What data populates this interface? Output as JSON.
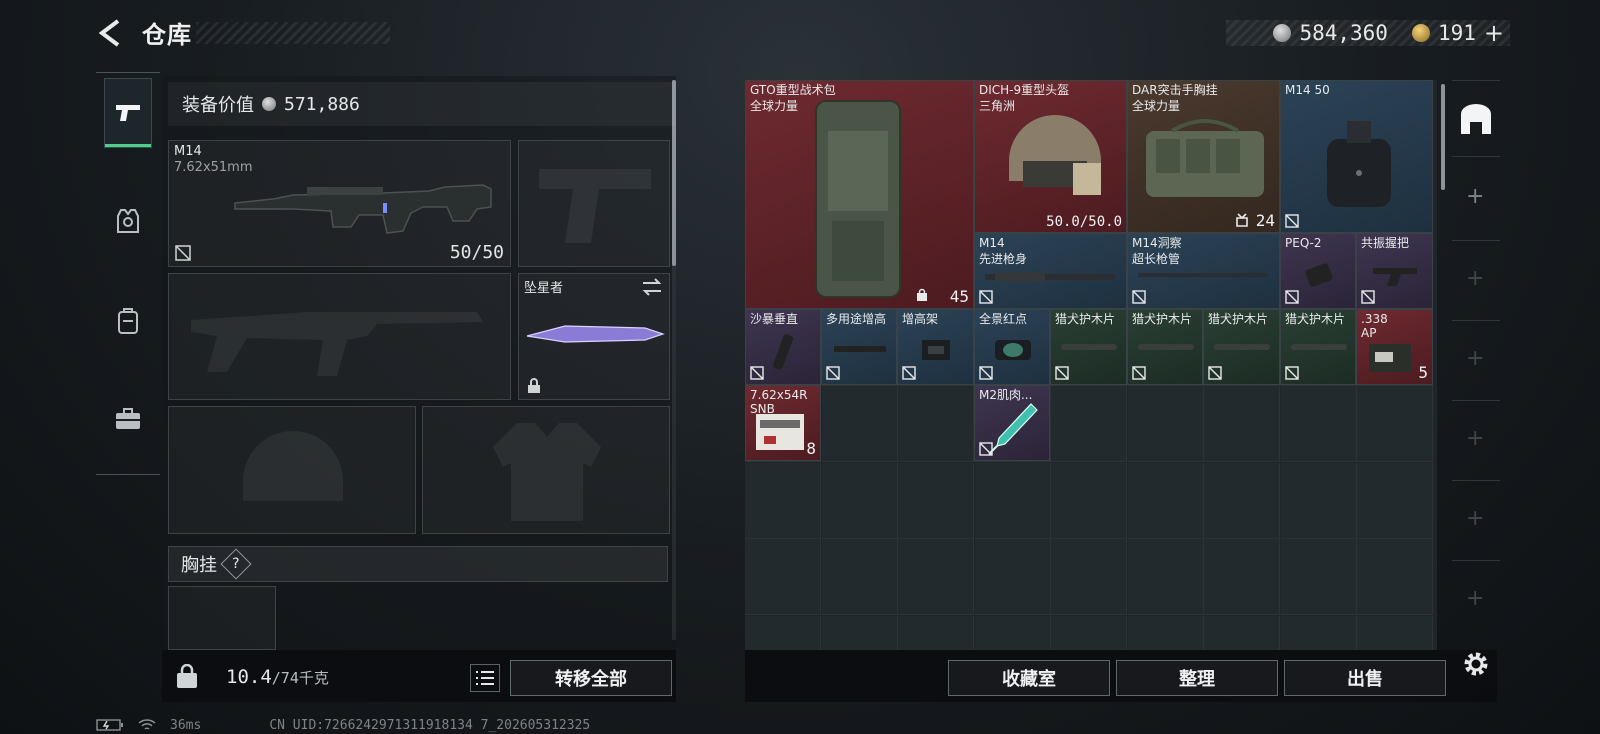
{
  "header": {
    "title": "仓库",
    "currency_silver": "584,360",
    "currency_gold": "191",
    "add_label": "+"
  },
  "left": {
    "equip_value_label": "装备价值",
    "equip_value": "571,886",
    "primary_weapon": {
      "name": "M14",
      "caliber": "7.62x51mm",
      "ammo": "50/50"
    },
    "melee": {
      "name": "坠星者"
    },
    "chest_rig_label": "胸挂",
    "help_glyph": "?",
    "weight_current": "10.4",
    "weight_capacity": "/74千克",
    "transfer_all": "转移全部"
  },
  "grid": {
    "items": [
      {
        "id": "backpack",
        "name": "GTO重型战术包",
        "sub": "全球力量",
        "count": "45",
        "color": "red"
      },
      {
        "id": "helmet",
        "name": "DICH-9重型头盔",
        "sub": "三角洲",
        "count": "50.0/50.0",
        "color": "red"
      },
      {
        "id": "chest",
        "name": "DAR突击手胸挂",
        "sub": "全球力量",
        "count": "24",
        "color": "brown"
      },
      {
        "id": "mag",
        "name": "M14 50",
        "sub": "",
        "count": "",
        "color": "blue"
      },
      {
        "id": "barrel1",
        "name": "M14",
        "sub": "先进枪身",
        "count": "",
        "color": "blue"
      },
      {
        "id": "barrel2",
        "name": "M14洞察",
        "sub": "超长枪管",
        "count": "",
        "color": "blue"
      },
      {
        "id": "peq",
        "name": "PEQ-2",
        "sub": "",
        "count": "",
        "color": "purple"
      },
      {
        "id": "grip",
        "name": "共振握把",
        "sub": "",
        "count": "",
        "color": "purple"
      },
      {
        "id": "vgrip",
        "name": "沙暴垂直",
        "sub": "",
        "count": "",
        "color": "purple"
      },
      {
        "id": "riser1",
        "name": "多用途增高",
        "sub": "",
        "count": "",
        "color": "blue"
      },
      {
        "id": "riser2",
        "name": "增高架",
        "sub": "",
        "count": "",
        "color": "blue"
      },
      {
        "id": "reddot",
        "name": "全景红点",
        "sub": "",
        "count": "",
        "color": "blue"
      },
      {
        "id": "guard1",
        "name": "猎犬护木片",
        "sub": "",
        "count": "",
        "color": "green"
      },
      {
        "id": "guard2",
        "name": "猎犬护木片",
        "sub": "",
        "count": "",
        "color": "green"
      },
      {
        "id": "guard3",
        "name": "猎犬护木片",
        "sub": "",
        "count": "",
        "color": "green"
      },
      {
        "id": "guard4",
        "name": "猎犬护木片",
        "sub": "",
        "count": "",
        "color": "green"
      },
      {
        "id": "ammo338",
        "name": ".338",
        "sub": "AP",
        "count": "5",
        "color": "red"
      },
      {
        "id": "ammo762",
        "name": "7.62x54R",
        "sub": "SNB",
        "count": "8",
        "color": "red"
      },
      {
        "id": "m2",
        "name": "M2肌肉...",
        "sub": "",
        "count": "",
        "color": "purple"
      }
    ]
  },
  "buttons": {
    "collection": "收藏室",
    "organize": "整理",
    "sell": "出售"
  },
  "status": {
    "ping": "36ms",
    "uid": "CN UID:7266242971311918134 7_202605312325"
  },
  "colors": {
    "accent_green": "#4fd08a",
    "rarity_red": "#6e2a30",
    "rarity_blue": "#2c4356",
    "rarity_green": "#2a3f34",
    "rarity_purple": "#3f3550",
    "rarity_brown": "#4b3a2e"
  }
}
